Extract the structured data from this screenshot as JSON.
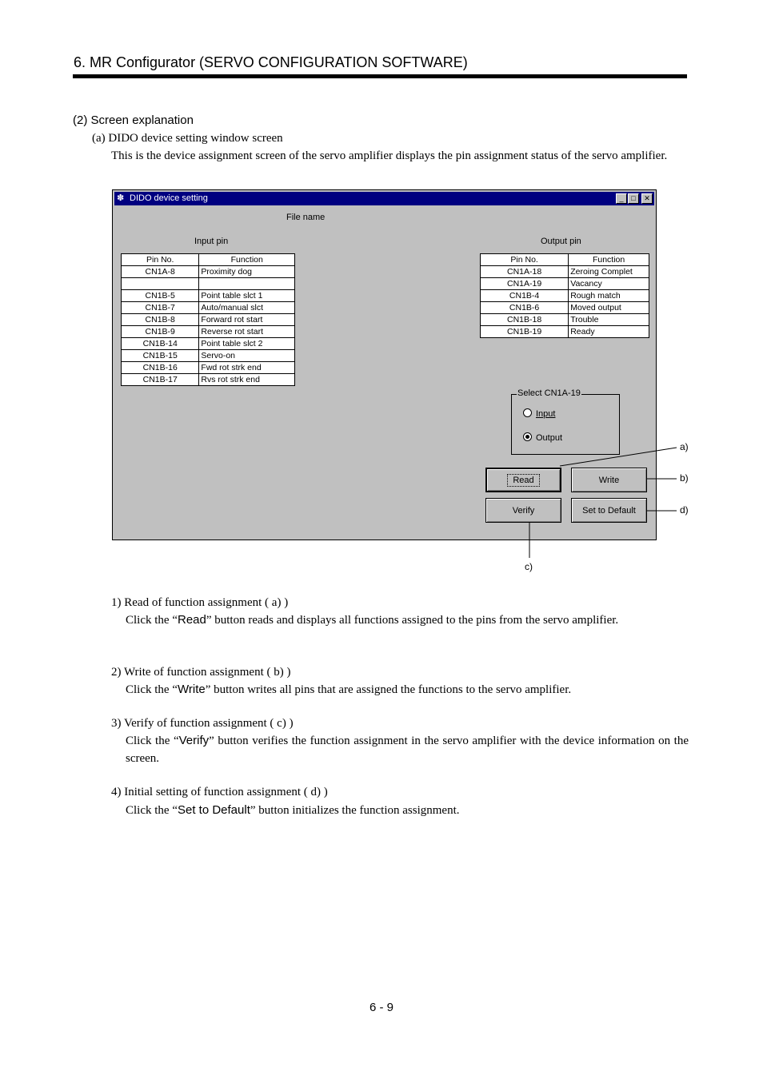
{
  "header": "6. MR Configurator (SERVO CONFIGURATION SOFTWARE)",
  "section": "(2) Screen explanation",
  "subsection": "(a) DIDO device setting window screen",
  "intro": "This is the device assignment screen of the servo amplifier displays the pin assignment status of the servo amplifier.",
  "window": {
    "title": "DIDO device setting",
    "file_name_label": "File name",
    "input_pin_label": "Input pin",
    "output_pin_label": "Output pin",
    "col_pin": "Pin No.",
    "col_function": "Function",
    "input_rows": [
      {
        "pin": "CN1A-8",
        "func": "Proximity dog"
      },
      {
        "pin": "",
        "func": ""
      },
      {
        "pin": "CN1B-5",
        "func": "Point table slct 1"
      },
      {
        "pin": "CN1B-7",
        "func": "Auto/manual slct"
      },
      {
        "pin": "CN1B-8",
        "func": "Forward rot start"
      },
      {
        "pin": "CN1B-9",
        "func": "Reverse rot start"
      },
      {
        "pin": "CN1B-14",
        "func": "Point table slct 2"
      },
      {
        "pin": "CN1B-15",
        "func": "Servo-on"
      },
      {
        "pin": "CN1B-16",
        "func": "Fwd rot strk end"
      },
      {
        "pin": "CN1B-17",
        "func": "Rvs rot strk end"
      }
    ],
    "output_rows": [
      {
        "pin": "CN1A-18",
        "func": "Zeroing Complet"
      },
      {
        "pin": "CN1A-19",
        "func": "Vacancy"
      },
      {
        "pin": "CN1B-4",
        "func": "Rough match"
      },
      {
        "pin": "CN1B-6",
        "func": "Moved output"
      },
      {
        "pin": "CN1B-18",
        "func": "Trouble"
      },
      {
        "pin": "CN1B-19",
        "func": "Ready"
      }
    ],
    "select_group": "Select CN1A-19",
    "radio_input": "Input",
    "radio_output": "Output",
    "btn_read": "Read",
    "btn_write": "Write",
    "btn_verify": "Verify",
    "btn_default": "Set to Default"
  },
  "annotations": {
    "a": "a)",
    "b": "b)",
    "c": "c)",
    "d": "d)"
  },
  "items": [
    {
      "title": "1) Read of function assignment ( a) )",
      "pre": "Click the “",
      "btn": "Read",
      "post": "” button reads and displays all functions assigned to the pins from the servo amplifier."
    },
    {
      "title": "2) Write of function assignment ( b) )",
      "pre": "Click the “",
      "btn": "Write",
      "post": "” button writes all pins that are assigned the functions to the servo amplifier."
    },
    {
      "title": "3) Verify of function assignment ( c) )",
      "pre": "Click the “",
      "btn": "Verify",
      "post": "” button verifies the function assignment in the servo amplifier with the device information on the screen."
    },
    {
      "title": "4) Initial setting of function assignment ( d) )",
      "pre": "Click the “",
      "btn": "Set to Default",
      "post": "” button initializes the function assignment."
    }
  ],
  "page_number": "6 -  9"
}
